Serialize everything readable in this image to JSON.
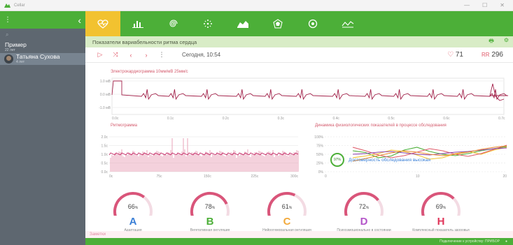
{
  "window": {
    "title": "Cellar",
    "min": "—",
    "max": "☐",
    "close": "✕"
  },
  "sidebar": {
    "menu_icon": "⋮",
    "back_icon": "‹",
    "search_icon": "⌕",
    "patients": [
      {
        "name": "Пример",
        "age": "22 лет"
      },
      {
        "name": "Татьяна Сухова",
        "age": "4 лет"
      }
    ]
  },
  "tabs": [
    {
      "icon": "heart-pulse-icon",
      "active": true
    },
    {
      "icon": "bar-chart-icon",
      "active": false
    },
    {
      "icon": "spiral-icon",
      "active": false
    },
    {
      "icon": "snowflake-icon",
      "active": false
    },
    {
      "icon": "area-chart-icon",
      "active": false
    },
    {
      "icon": "radar-icon",
      "active": false
    },
    {
      "icon": "circle-arrow-icon",
      "active": false
    },
    {
      "icon": "line-chart-icon",
      "active": false
    }
  ],
  "subheader": {
    "title": "Показатели вариабельности ритма сердца",
    "print_icon": "🖶",
    "settings_icon": "⚙"
  },
  "toolbar": {
    "date": "Сегодня, 10:54",
    "hr_value": "71",
    "rr_label": "RR",
    "rr_value": "296",
    "colors": {
      "accent": "#e05a6a"
    }
  },
  "ecg": {
    "title": "Электрокардиограмма 10мм/мВ 25мм/с",
    "y_ticks": [
      "1.0 мВ",
      "0.0 мВ",
      "-1.0 мВ"
    ],
    "x_ticks": [
      "0.0с",
      "0.1с",
      "0.2с",
      "0.3с",
      "0.4с",
      "0.5с",
      "0.6с",
      "0.7с"
    ]
  },
  "rhythm": {
    "title": "Ритмограмма",
    "y_ticks": [
      "2.0с",
      "1.5с",
      "1.0с",
      "0.5с",
      "0.0с"
    ],
    "x_ticks": [
      "0с",
      "75с",
      "150с",
      "225с",
      "300с"
    ]
  },
  "dynamics": {
    "title": "Динамика физиологических показателей в процессе обследования",
    "y_ticks": [
      "100%",
      "75%",
      "50%",
      "25%",
      "0%"
    ],
    "x_ticks": [
      "0",
      "10",
      "20"
    ],
    "reliability_value": "97%",
    "reliability_text": "Достоверность обследования высокая",
    "series_colors": [
      "#4caf38",
      "#f2c230",
      "#e05a6a",
      "#8e44ad",
      "#e8872a"
    ]
  },
  "gauges": [
    {
      "value": "66",
      "unit": "%",
      "letter": "A",
      "caption": "Адаптация",
      "color": "#3a7fd6",
      "fraction": 0.66
    },
    {
      "value": "78",
      "unit": "%",
      "letter": "B",
      "caption": "Вегетативная регуляция",
      "color": "#4caf38",
      "fraction": 0.78
    },
    {
      "value": "61",
      "unit": "%",
      "letter": "C",
      "caption": "Нейрогуморальная регуляция",
      "color": "#f2a93b",
      "fraction": 0.61
    },
    {
      "value": "72",
      "unit": "%",
      "letter": "D",
      "caption": "Психоэмоционально в состоянии",
      "color": "#b455c9",
      "fraction": 0.72
    },
    {
      "value": "69",
      "unit": "%",
      "letter": "H",
      "caption": "Комплексный показатель здоровья",
      "color": "#e0365a",
      "fraction": 0.69
    }
  ],
  "notes": {
    "label": "Заметки"
  },
  "status": {
    "text": "Подключение к устройству: ПРИБОР"
  }
}
